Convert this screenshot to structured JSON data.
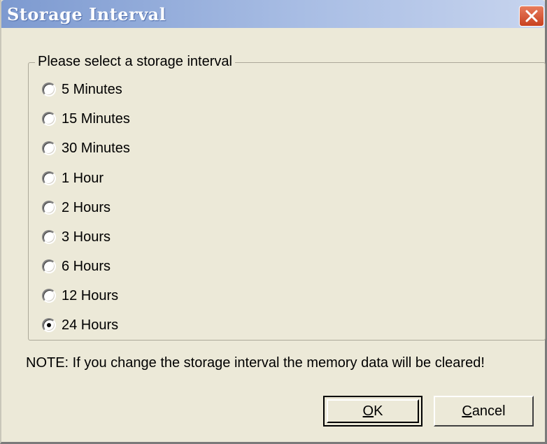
{
  "window": {
    "title": "Storage Interval"
  },
  "group": {
    "legend": "Please select a storage interval",
    "options": [
      {
        "label": "5 Minutes",
        "checked": false
      },
      {
        "label": "15 Minutes",
        "checked": false
      },
      {
        "label": "30 Minutes",
        "checked": false
      },
      {
        "label": "1 Hour",
        "checked": false
      },
      {
        "label": "2 Hours",
        "checked": false
      },
      {
        "label": "3 Hours",
        "checked": false
      },
      {
        "label": "6 Hours",
        "checked": false
      },
      {
        "label": "12 Hours",
        "checked": false
      },
      {
        "label": "24 Hours",
        "checked": true
      }
    ]
  },
  "note": "NOTE: If you change the storage interval the memory data will be cleared!",
  "buttons": {
    "ok_first": "O",
    "ok_rest": "K",
    "cancel_first": "C",
    "cancel_rest": "ancel"
  },
  "icons": {
    "close": "close-icon"
  },
  "colors": {
    "title_gradient_start": "#7d9ad0",
    "close_button": "#c8401f",
    "dialog_bg": "#ece9d8"
  }
}
